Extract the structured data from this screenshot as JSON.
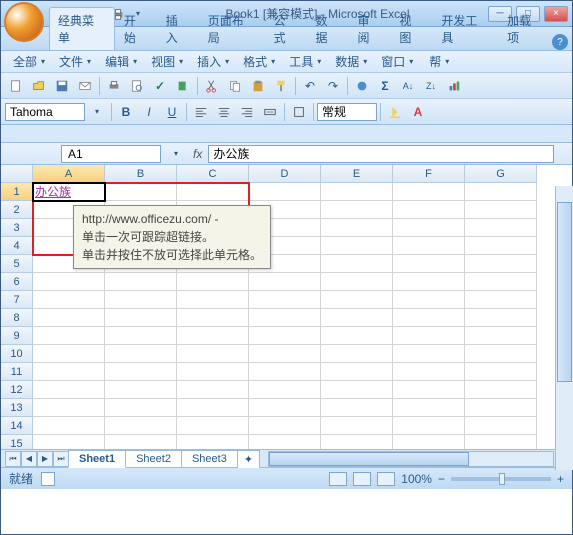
{
  "title": "Book1 [兼容模式] - Microsoft Excel",
  "tabs": [
    "经典菜单",
    "开始",
    "插入",
    "页面布局",
    "公式",
    "数据",
    "审阅",
    "视图",
    "开发工具",
    "加载项"
  ],
  "active_tab": 0,
  "menus": [
    "全部",
    "文件",
    "编辑",
    "视图",
    "插入",
    "格式",
    "工具",
    "数据",
    "窗口",
    "帮"
  ],
  "font_name": "Tahoma",
  "style_label": "常规",
  "namebox": "A1",
  "fx": "fx",
  "formula": "办公族",
  "cell_a1": "办公族",
  "cols": [
    "A",
    "B",
    "C",
    "D",
    "E",
    "F",
    "G"
  ],
  "rows": [
    "1",
    "2",
    "3",
    "4",
    "5",
    "6",
    "7",
    "8",
    "9",
    "10",
    "11",
    "12",
    "13",
    "14",
    "15"
  ],
  "tooltip": {
    "line1": "http://www.officezu.com/ -",
    "line2": "单击一次可跟踪超链接。",
    "line3": "单击并按住不放可选择此单元格。"
  },
  "sheets": [
    "Sheet1",
    "Sheet2",
    "Sheet3"
  ],
  "active_sheet": 0,
  "status": "就绪",
  "zoom": "100%",
  "zoom_minus": "−",
  "zoom_plus": "+"
}
